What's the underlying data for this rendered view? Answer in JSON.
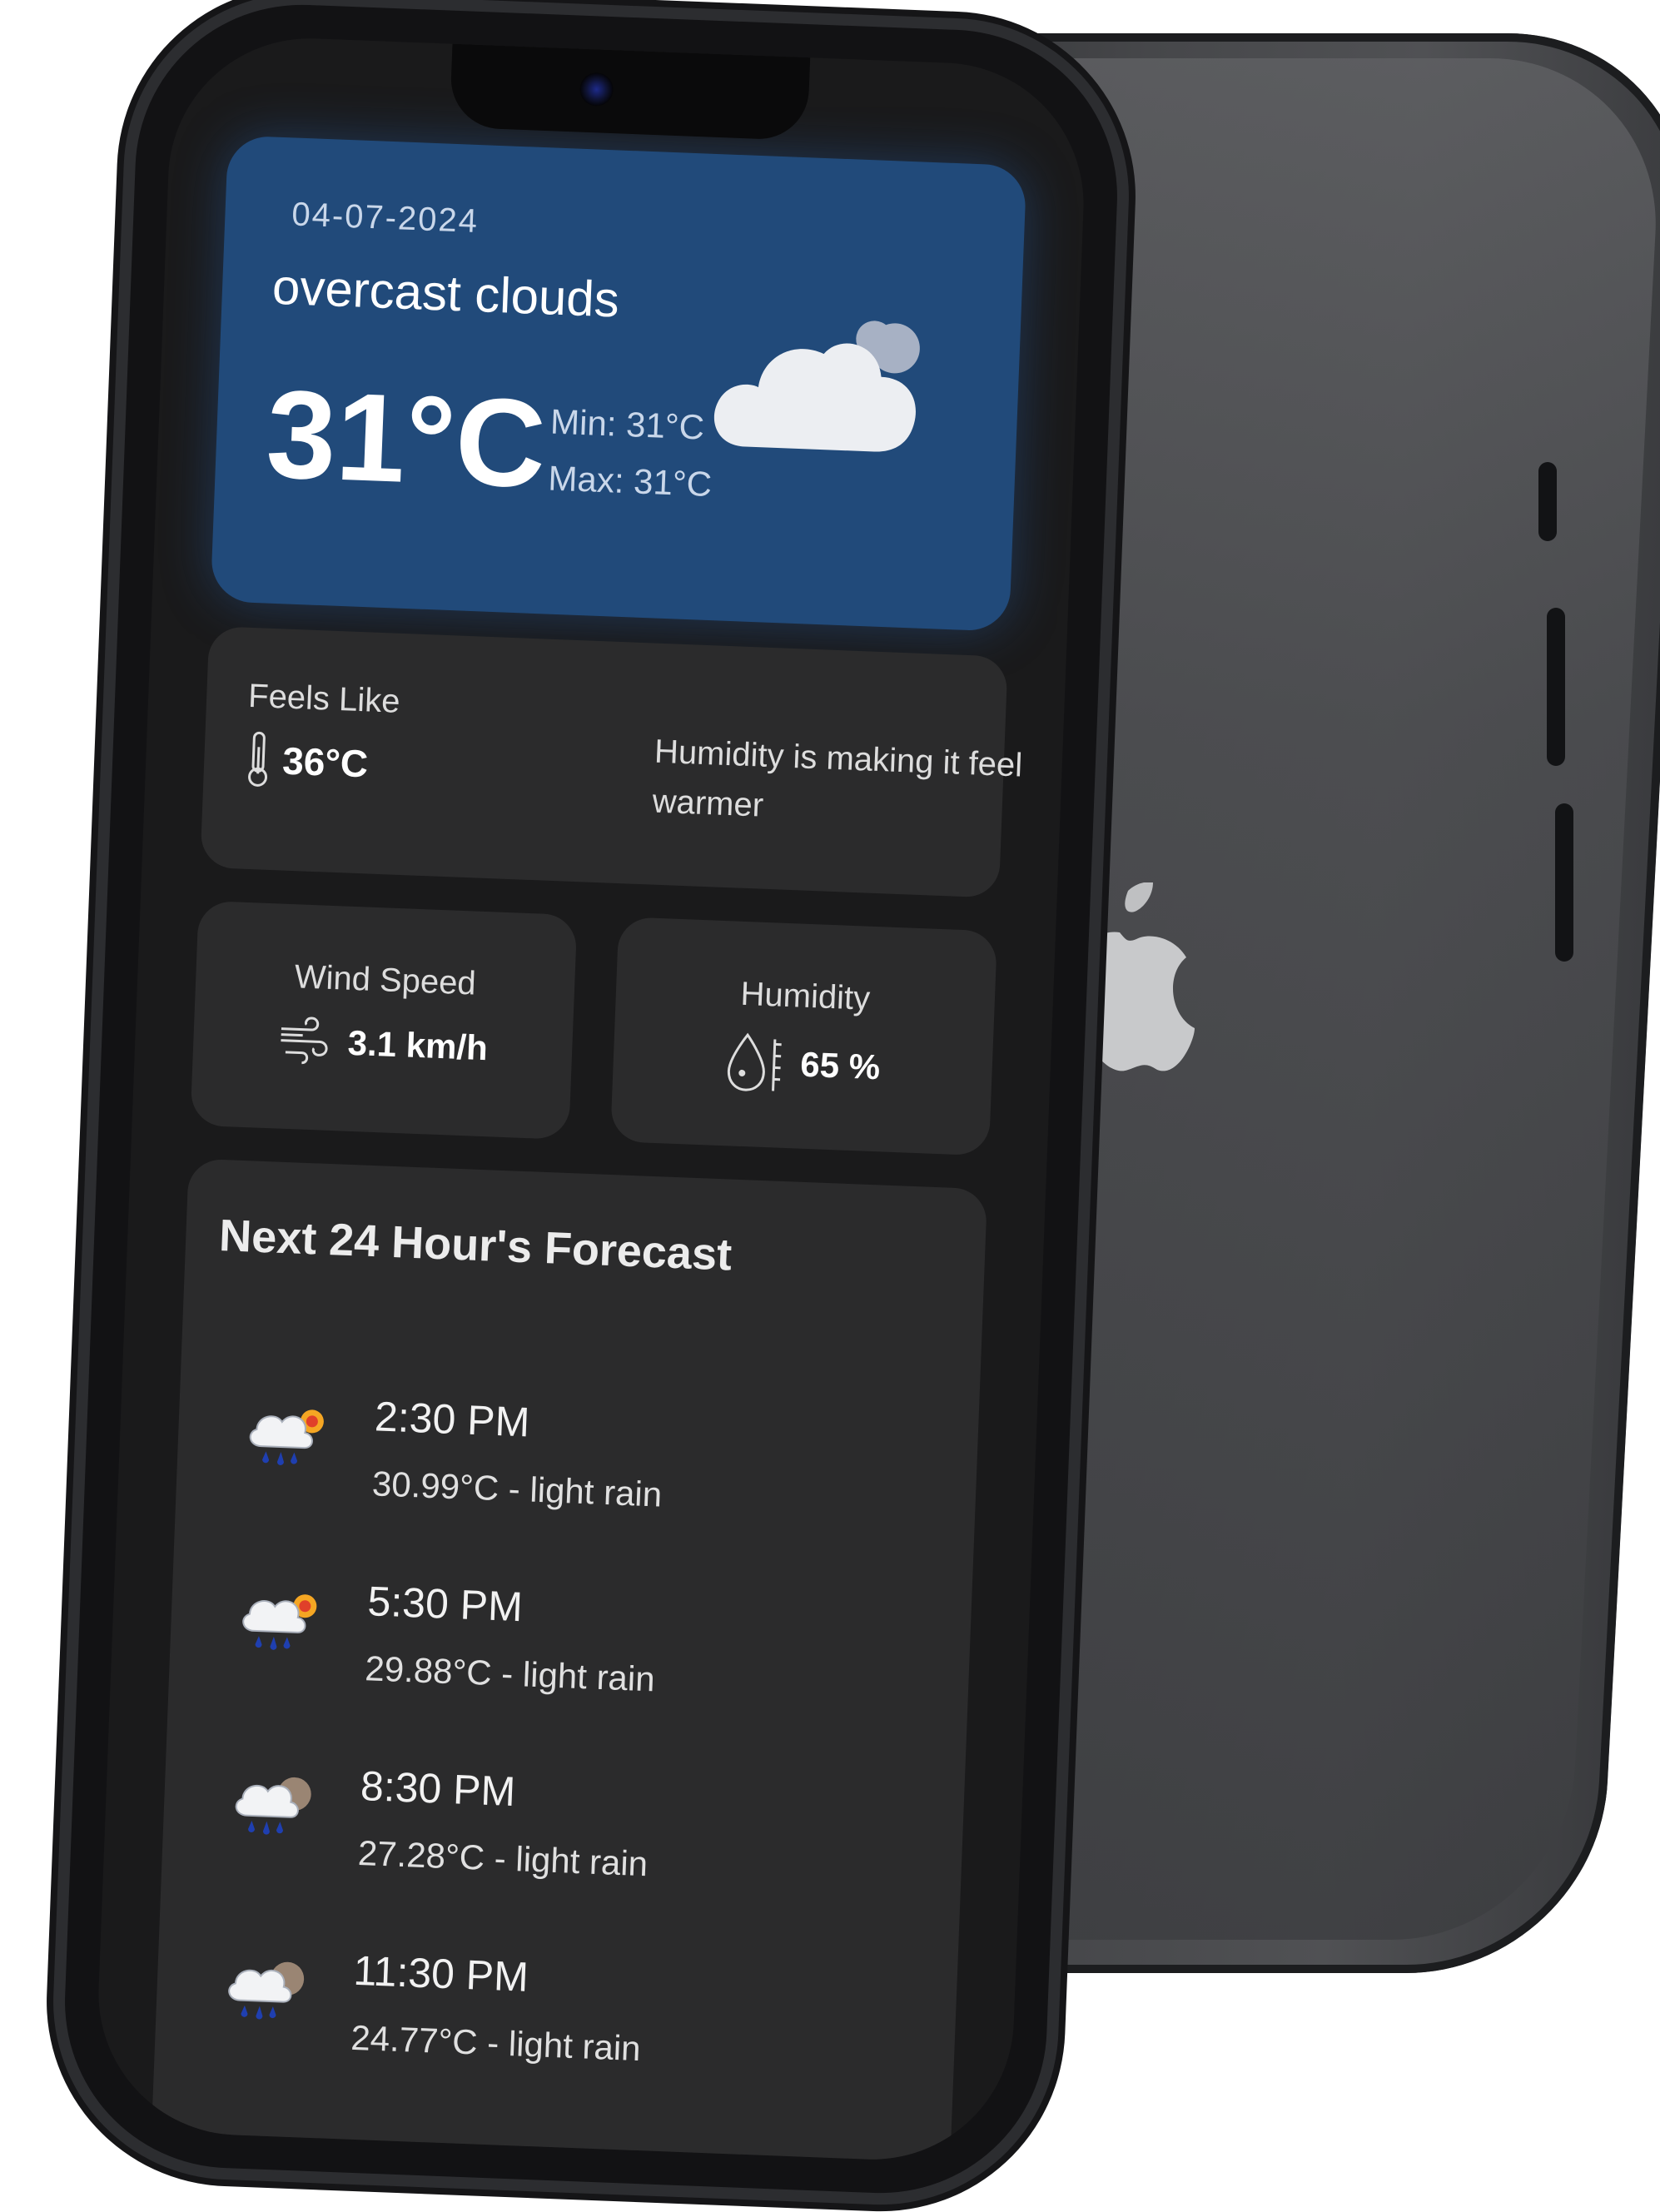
{
  "current": {
    "date": "04-07-2024",
    "description": "overcast clouds",
    "temperature": "31°C",
    "min": "Min: 31°C",
    "max": "Max: 31°C",
    "icon": "overcast-cloud-icon"
  },
  "feels_like": {
    "label": "Feels Like",
    "value": "36°C",
    "note": "Humidity is making it feel warmer",
    "icon": "thermometer-icon"
  },
  "wind": {
    "label": "Wind Speed",
    "value": "3.1 km/h",
    "icon": "wind-icon"
  },
  "humidity": {
    "label": "Humidity",
    "value": "65 %",
    "icon": "humidity-drop-icon"
  },
  "forecast": {
    "title": "Next 24 Hour's Forecast",
    "items": [
      {
        "time": "2:30 PM",
        "detail": "30.99°C - light rain",
        "icon": "rain-sun-icon"
      },
      {
        "time": "5:30 PM",
        "detail": "29.88°C - light rain",
        "icon": "rain-sun-icon"
      },
      {
        "time": "8:30 PM",
        "detail": "27.28°C - light rain",
        "icon": "rain-moon-icon"
      },
      {
        "time": "11:30 PM",
        "detail": "24.77°C - light rain",
        "icon": "rain-moon-icon"
      }
    ]
  },
  "colors": {
    "hero_bg": "#214a7a",
    "card_bg": "#2b2b2c",
    "screen_bg": "#1a1a1b"
  }
}
